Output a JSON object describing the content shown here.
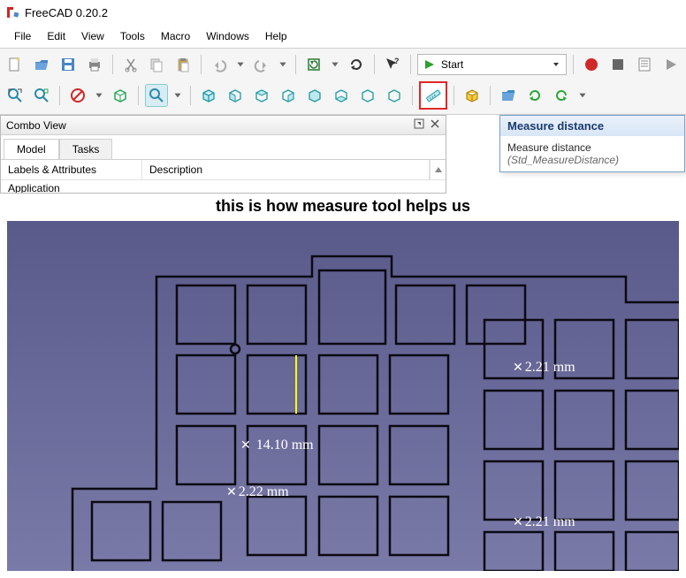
{
  "app": {
    "title": "FreeCAD 0.20.2"
  },
  "menu": [
    "File",
    "Edit",
    "View",
    "Tools",
    "Macro",
    "Windows",
    "Help"
  ],
  "workbench": {
    "label": "Start"
  },
  "combo": {
    "title": "Combo View",
    "tabs": [
      "Model",
      "Tasks"
    ],
    "columns": [
      "Labels & Attributes",
      "Description"
    ],
    "tree_first": "Application"
  },
  "tooltip": {
    "title": "Measure distance",
    "line1": "Measure distance",
    "cmd": "(Std_MeasureDistance)"
  },
  "annotation": "this is how measure tool helps us",
  "measurements": {
    "m1": "14.10 mm",
    "m2": "2.22 mm",
    "m3": "2.21 mm",
    "m4": "2.21 mm"
  }
}
